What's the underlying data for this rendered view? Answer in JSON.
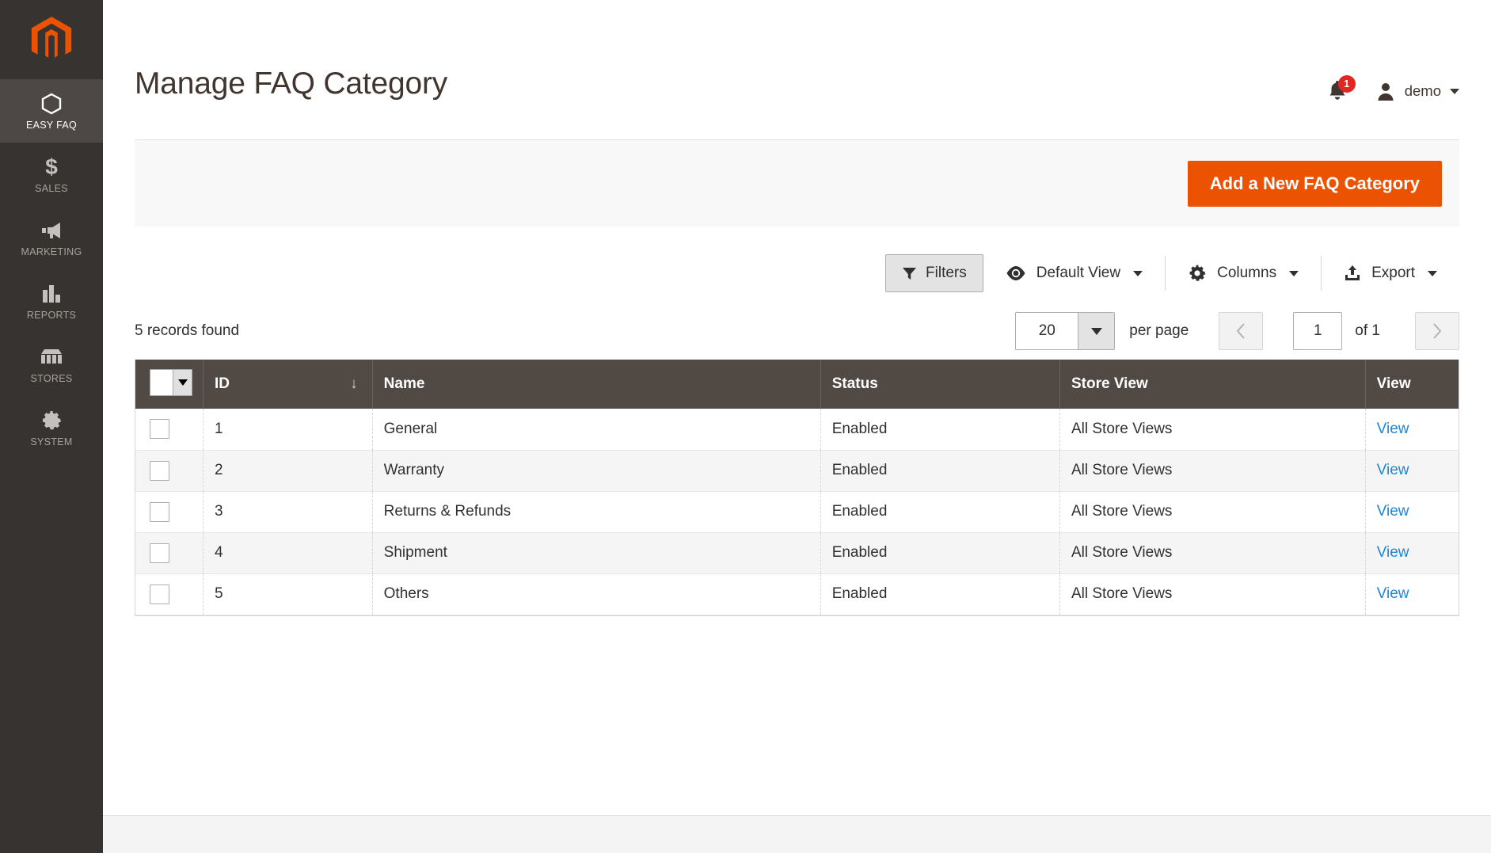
{
  "sidebar": {
    "logo": "magento-logo",
    "items": [
      {
        "label": "EASY FAQ",
        "icon": "hexagon-icon",
        "active": true
      },
      {
        "label": "SALES",
        "icon": "dollar-icon",
        "active": false
      },
      {
        "label": "MARKETING",
        "icon": "megaphone-icon",
        "active": false
      },
      {
        "label": "REPORTS",
        "icon": "bar-chart-icon",
        "active": false
      },
      {
        "label": "STORES",
        "icon": "storefront-icon",
        "active": false
      },
      {
        "label": "SYSTEM",
        "icon": "gear-icon",
        "active": false
      }
    ]
  },
  "header": {
    "title": "Manage FAQ Category",
    "notifications_count": "1",
    "user_name": "demo"
  },
  "action_bar": {
    "add_button_label": "Add a New FAQ Category"
  },
  "toolbar": {
    "filters_label": "Filters",
    "view_label": "Default View",
    "columns_label": "Columns",
    "export_label": "Export"
  },
  "pager": {
    "records_found": "5 records found",
    "per_page_value": "20",
    "per_page_label": "per page",
    "current_page": "1",
    "of_label": "of 1"
  },
  "grid": {
    "columns": [
      "ID",
      "Name",
      "Status",
      "Store View",
      "View"
    ],
    "sort_column": "ID",
    "sort_direction_glyph": "↓",
    "rows": [
      {
        "id": "1",
        "name": "General",
        "status": "Enabled",
        "store_view": "All Store Views",
        "view": "View"
      },
      {
        "id": "2",
        "name": "Warranty",
        "status": "Enabled",
        "store_view": "All Store Views",
        "view": "View"
      },
      {
        "id": "3",
        "name": "Returns & Refunds",
        "status": "Enabled",
        "store_view": "All Store Views",
        "view": "View"
      },
      {
        "id": "4",
        "name": "Shipment",
        "status": "Enabled",
        "store_view": "All Store Views",
        "view": "View"
      },
      {
        "id": "5",
        "name": "Others",
        "status": "Enabled",
        "store_view": "All Store Views",
        "view": "View"
      }
    ]
  },
  "colors": {
    "accent_orange": "#eb5202",
    "sidebar_bg": "#373330",
    "sidebar_active_bg": "#4d4845",
    "table_header_bg": "#514943",
    "link_blue": "#1f86d6",
    "badge_red": "#e22626"
  }
}
